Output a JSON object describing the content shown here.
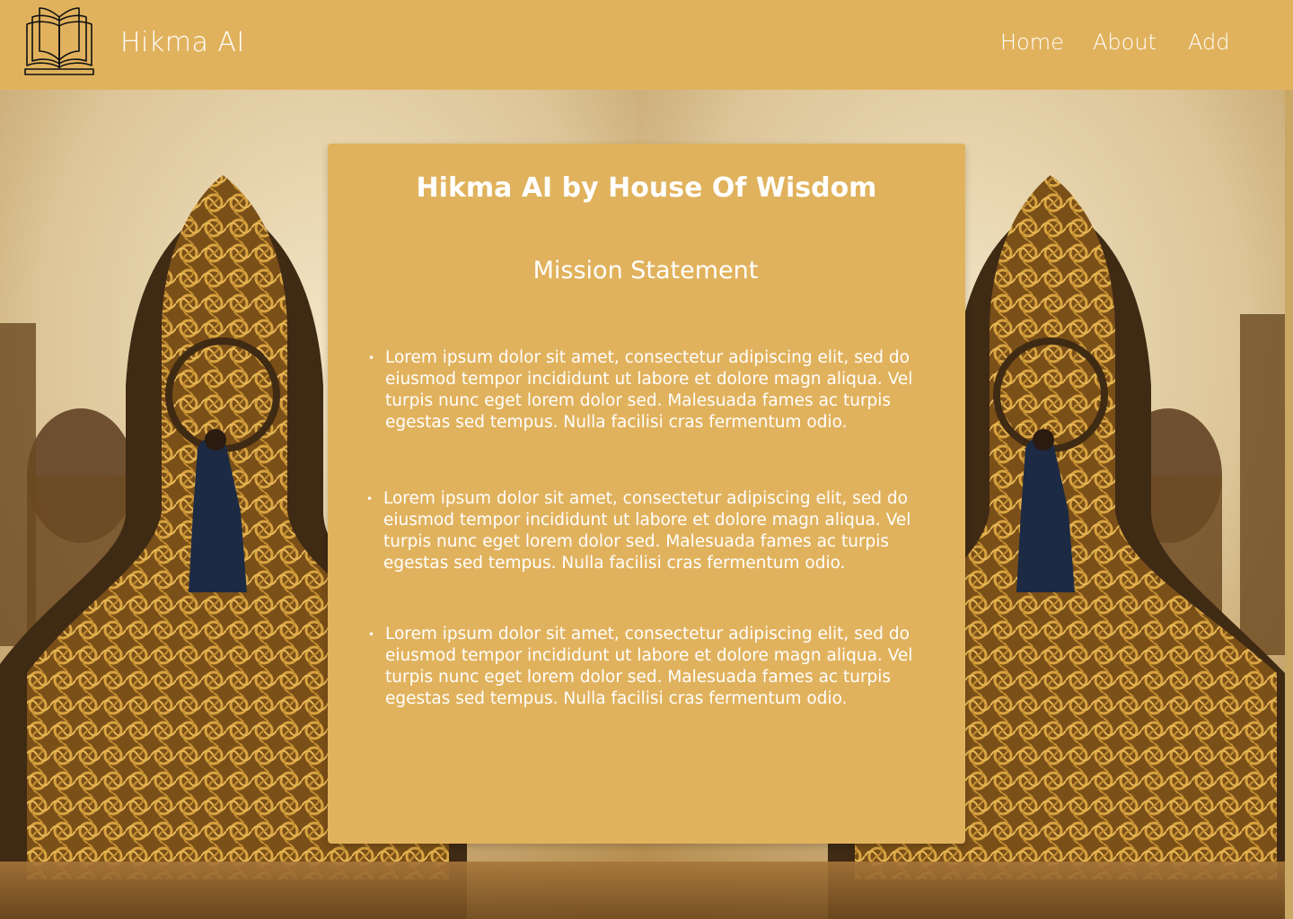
{
  "header": {
    "brand": "Hikma AI",
    "logo_icon": "open-book-icon",
    "nav": [
      {
        "label": "Home"
      },
      {
        "label": "About"
      },
      {
        "label": "Add"
      }
    ]
  },
  "card": {
    "title": "Hikma AI by House Of Wisdom",
    "subtitle": "Mission Statement",
    "bullets": [
      "Lorem ipsum dolor sit amet, consectetur adipiscing elit, sed do eiusmod tempor incididunt ut labore et dolore magn aliqua. Vel turpis nunc eget lorem dolor sed. Malesuada fames ac turpis egestas sed tempus. Nulla facilisi cras fermentum odio.",
      "Lorem ipsum dolor sit amet, consectetur adipiscing elit, sed do eiusmod tempor incididunt ut labore et dolore magn aliqua. Vel turpis nunc eget lorem dolor sed. Malesuada fames ac turpis egestas sed tempus. Nulla facilisi cras fermentum odio.",
      "Lorem ipsum dolor sit amet, consectetur adipiscing elit, sed do eiusmod tempor incididunt ut labore et dolore magn aliqua. Vel turpis nunc eget lorem dolor sed. Malesuada fames ac turpis egestas sed tempus. Nulla facilisi cras fermentum odio."
    ]
  },
  "colors": {
    "accent": "#e1b25d",
    "text": "#ffffff"
  }
}
